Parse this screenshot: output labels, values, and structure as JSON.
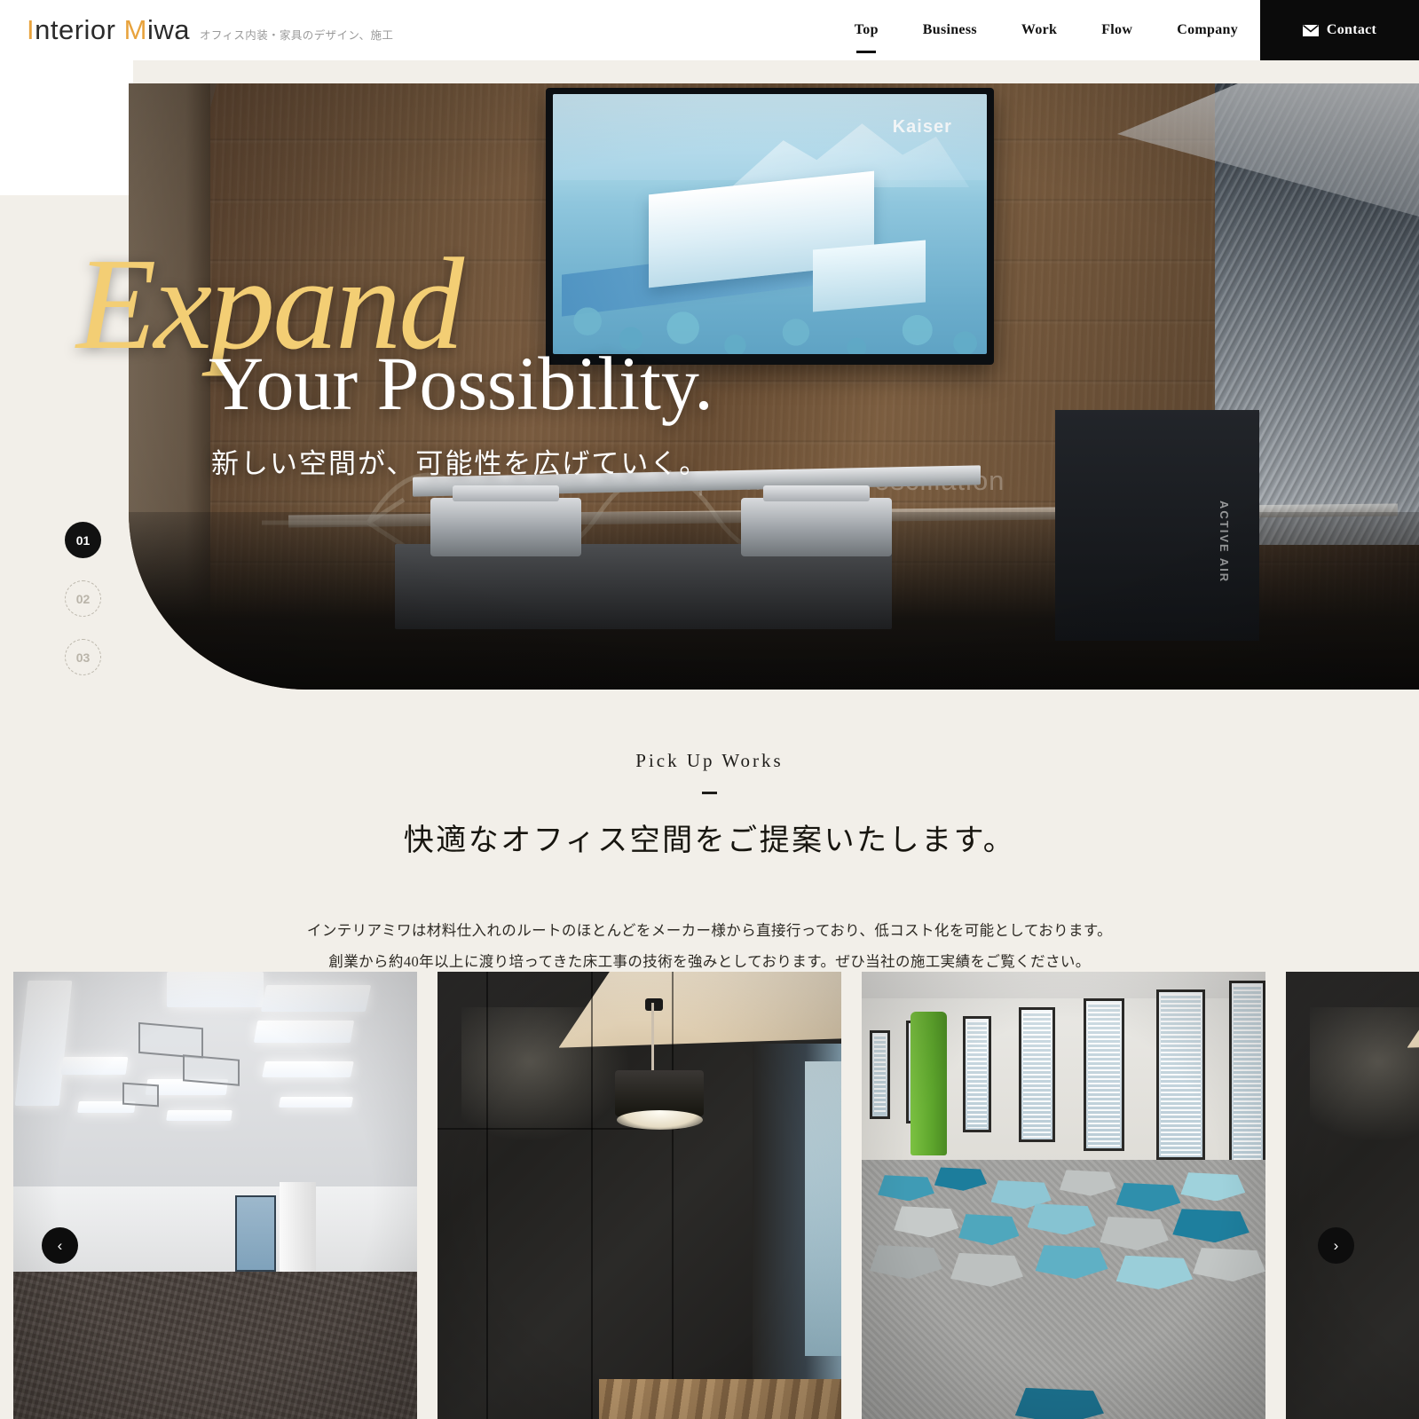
{
  "header": {
    "logo": {
      "part1": "I",
      "part2": "nterior ",
      "part3": "M",
      "part4": "iwa"
    },
    "logo_full": "Interior Miwa",
    "tagline": "オフィス内装・家具のデザイン、施工",
    "nav": [
      {
        "label": "Top",
        "active": true
      },
      {
        "label": "Business",
        "active": false
      },
      {
        "label": "Work",
        "active": false
      },
      {
        "label": "Flow",
        "active": false
      },
      {
        "label": "Company",
        "active": false
      }
    ],
    "contact": {
      "label": "Contact",
      "icon": "mail-icon",
      "bg": "#0b0b0b"
    }
  },
  "hero": {
    "script_word": "Expand",
    "headline": "Your Possibility.",
    "subtitle": "新しい空間が、可能性を広げていく。",
    "script_color": "#F3CE74",
    "photo": {
      "alt": "オフィス内装 木目壁とモニターのある空間",
      "tv_logo": "Kaiser",
      "wall_text": "simple harmonic oscillation",
      "cabinet_label": "ACTIVE AIR"
    },
    "slides": [
      {
        "number": "01",
        "active": true
      },
      {
        "number": "02",
        "active": false
      },
      {
        "number": "03",
        "active": false
      }
    ]
  },
  "pickup": {
    "eyebrow": "Pick Up Works",
    "title": "快適なオフィス空間をご提案いたします。",
    "desc_line1": "インテリアミワは材料仕入れのルートのほとんどをメーカー様から直接行っており、低コスト化を可能としております。",
    "desc_line2": "創業から約40年以上に渡り培ってきた床工事の技術を強みとしております。ぜひ当社の施工実績をご覧ください。"
  },
  "carousel": {
    "prev_label": "‹",
    "next_label": "›",
    "slides": [
      {
        "alt": "施工実績 暗い室内"
      },
      {
        "alt": "施工実績 明るいオフィス空間"
      },
      {
        "alt": "施工実績 黒い壁とペンダントライト"
      },
      {
        "alt": "施工実績 カラフルなタイルカーペットの廊下"
      },
      {
        "alt": "施工実績 次の写真"
      }
    ]
  },
  "colors": {
    "page_bg": "#F2EFE9",
    "accent_gold": "#E8A33D",
    "hero_script": "#F3CE74",
    "dark": "#0b0b0b"
  }
}
